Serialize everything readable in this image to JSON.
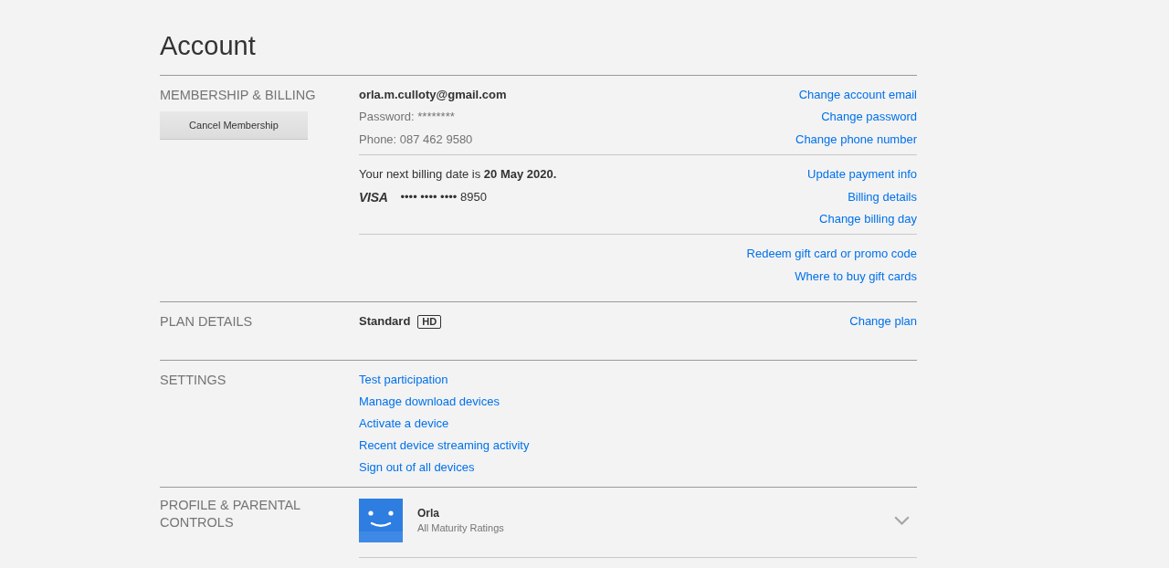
{
  "page": {
    "title": "Account"
  },
  "sections": [
    {
      "kind": "membership",
      "label": "MEMBERSHIP & BILLING",
      "button": "Cancel Membership",
      "groups": [
        {
          "items": [
            {
              "kind": "strong",
              "text": "**orla.m.culloty@gmail.com**"
            },
            {
              "kind": "muted",
              "text": "Password: ********"
            },
            {
              "kind": "muted",
              "text": "Phone: 087 462 9580"
            }
          ],
          "links": [
            "Change account email",
            "Change password",
            "Change phone number"
          ]
        },
        {
          "items": [
            {
              "kind": "plain",
              "text": "Your next billing date is **20 May 2020.**"
            },
            {
              "kind": "card",
              "brand": "VISA",
              "text": "•••• •••• •••• 8950"
            }
          ],
          "links": [
            "Update payment info",
            "Billing details",
            "Change billing day"
          ]
        },
        {
          "links": [
            "Redeem gift card or promo code",
            "Where to buy gift cards"
          ]
        }
      ]
    },
    {
      "kind": "plan",
      "label": "PLAN DETAILS",
      "plan": "Standard",
      "badge": "HD",
      "links": [
        "Change plan"
      ]
    },
    {
      "kind": "settings",
      "label": "SETTINGS",
      "links": [
        "Test participation",
        "Manage download devices",
        "Activate a device",
        "Recent device streaming activity",
        "Sign out of all devices"
      ]
    },
    {
      "kind": "profile",
      "label": "PROFILE & PARENTAL CONTROLS",
      "profiles": [
        {
          "name": "Orla",
          "rating": "All Maturity Ratings",
          "expanded": false
        }
      ]
    }
  ]
}
